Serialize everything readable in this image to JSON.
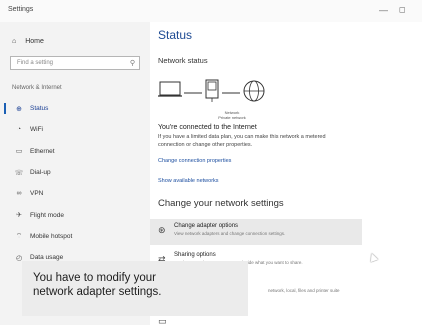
{
  "window": {
    "title": "Settings",
    "min_glyph": "—",
    "max_glyph": "◻"
  },
  "sidebar": {
    "home_label": "Home",
    "search_placeholder": "Find a setting",
    "section_title": "Network & Internet",
    "items": [
      {
        "label": "Status",
        "icon": "globe-icon"
      },
      {
        "label": "WiFi",
        "icon": "wifi-icon"
      },
      {
        "label": "Ethernet",
        "icon": "ethernet-icon"
      },
      {
        "label": "Dial-up",
        "icon": "phone-icon"
      },
      {
        "label": "VPN",
        "icon": "vpn-icon"
      },
      {
        "label": "Flight mode",
        "icon": "airplane-icon"
      },
      {
        "label": "Mobile hotspot",
        "icon": "hotspot-icon"
      },
      {
        "label": "Data usage",
        "icon": "gauge-icon"
      }
    ]
  },
  "main": {
    "title": "Status",
    "network_status_label": "Network status",
    "router_label_line1": "Network",
    "router_label_line2": "Private network",
    "connected_heading": "You're connected to the Internet",
    "connected_desc": "If you have a limited data plan, you can make this network a metered connection or change other properties.",
    "link_change_properties": "Change connection properties",
    "link_show_networks": "Show available networks",
    "change_heading": "Change your network settings",
    "options": [
      {
        "title": "Change adapter options",
        "desc": "View network adapters and change connection settings."
      },
      {
        "title": "Sharing options",
        "desc": "For the networks you connect to, decide what you want to share."
      },
      {
        "title": "",
        "desc": "network, local, files and printer suite"
      },
      {
        "title": "",
        "desc": ""
      }
    ]
  },
  "caption": {
    "line1": "You have to modify your",
    "line2": "network adapter settings."
  }
}
